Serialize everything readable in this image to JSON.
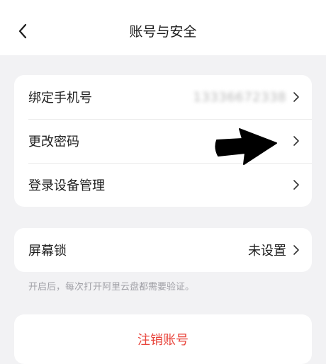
{
  "header": {
    "title": "账号与安全",
    "back_icon": "chevron-left-icon"
  },
  "security_items": [
    {
      "label": "绑定手机号",
      "value": "13336672338",
      "value_blurred": true
    },
    {
      "label": "更改密码",
      "value": ""
    },
    {
      "label": "登录设备管理",
      "value": ""
    }
  ],
  "screen_lock": {
    "label": "屏幕锁",
    "value": "未设置",
    "hint": "开启后，每次打开阿里云盘都需要验证。"
  },
  "cancel_account": {
    "label": "注销账号",
    "color": "#e8453c"
  },
  "colors": {
    "background": "#f2f2f4",
    "card": "#ffffff",
    "text": "#1f1f1f",
    "muted": "#a0a0a6"
  },
  "annotation": {
    "icon": "arrow-right-annotation-icon"
  }
}
